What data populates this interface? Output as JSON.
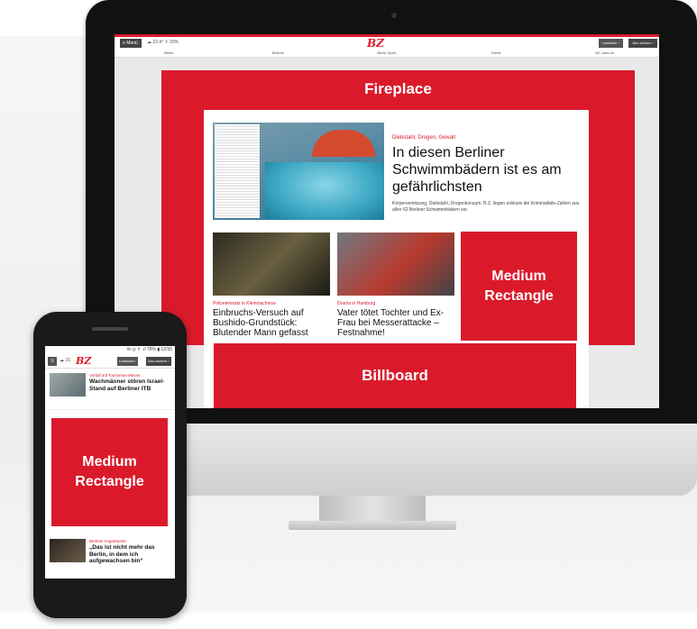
{
  "desktop": {
    "menu_label": "≡ Menü",
    "weather": "☁ 23,4°  ⇑ 20%",
    "logo": "BZ",
    "live_label": "Liveticker ›",
    "abo_label": "Abo sichern ›",
    "nav": [
      "Berlin",
      "Bezirke",
      "Berlin Sport",
      "Talent",
      "BZ-Jobs.de"
    ],
    "fireplace_label": "Fireplace",
    "hero": {
      "kicker": "Diebstahl, Drogen, Gewalt",
      "title": "In diesen Berliner Schwimmbädern ist es am gefährlichsten",
      "subtitle": "Körperverletzung, Diebstahl, Drogenkonsum. B.Z. liegen exklusiv die Kriminalitäts-Zahlen aus allen 62 Berliner Schwimmbädern vor."
    },
    "teasers": [
      {
        "kicker": "Polizeieinsatz in Kleinmachnow",
        "title": "Einbruchs-Versuch auf Bushido-Grundstück: Blutender Mann gefasst"
      },
      {
        "kicker": "Drama in Hamburg",
        "title": "Vater tötet Tochter und Ex-Frau bei Messerattacke – Festnahme!"
      }
    ],
    "medium_rectangle_label": "Medium Rectangle",
    "billboard_label": "Billboard"
  },
  "phone": {
    "status": "✉ ◎ ⇑ .ıl 76% ▮ 13:55",
    "menu": "≡",
    "weather": "☁ 15",
    "logo": "BZ",
    "live_label": "Liveticker ›",
    "abo_label": "Abo sichern ›",
    "news1": {
      "kicker": "Vorfall auf Tourismus-Messe",
      "title": "Wachmänner stören Israel-Stand auf Berliner ITB"
    },
    "medium_rectangle_label": "Medium Rectangle",
    "news2": {
      "kicker": "Berliner Angsträume",
      "title": "„Das ist nicht mehr das Berlin, in dem ich aufgewachsen bin“"
    }
  },
  "colors": {
    "brand_red": "#da1a2b"
  }
}
